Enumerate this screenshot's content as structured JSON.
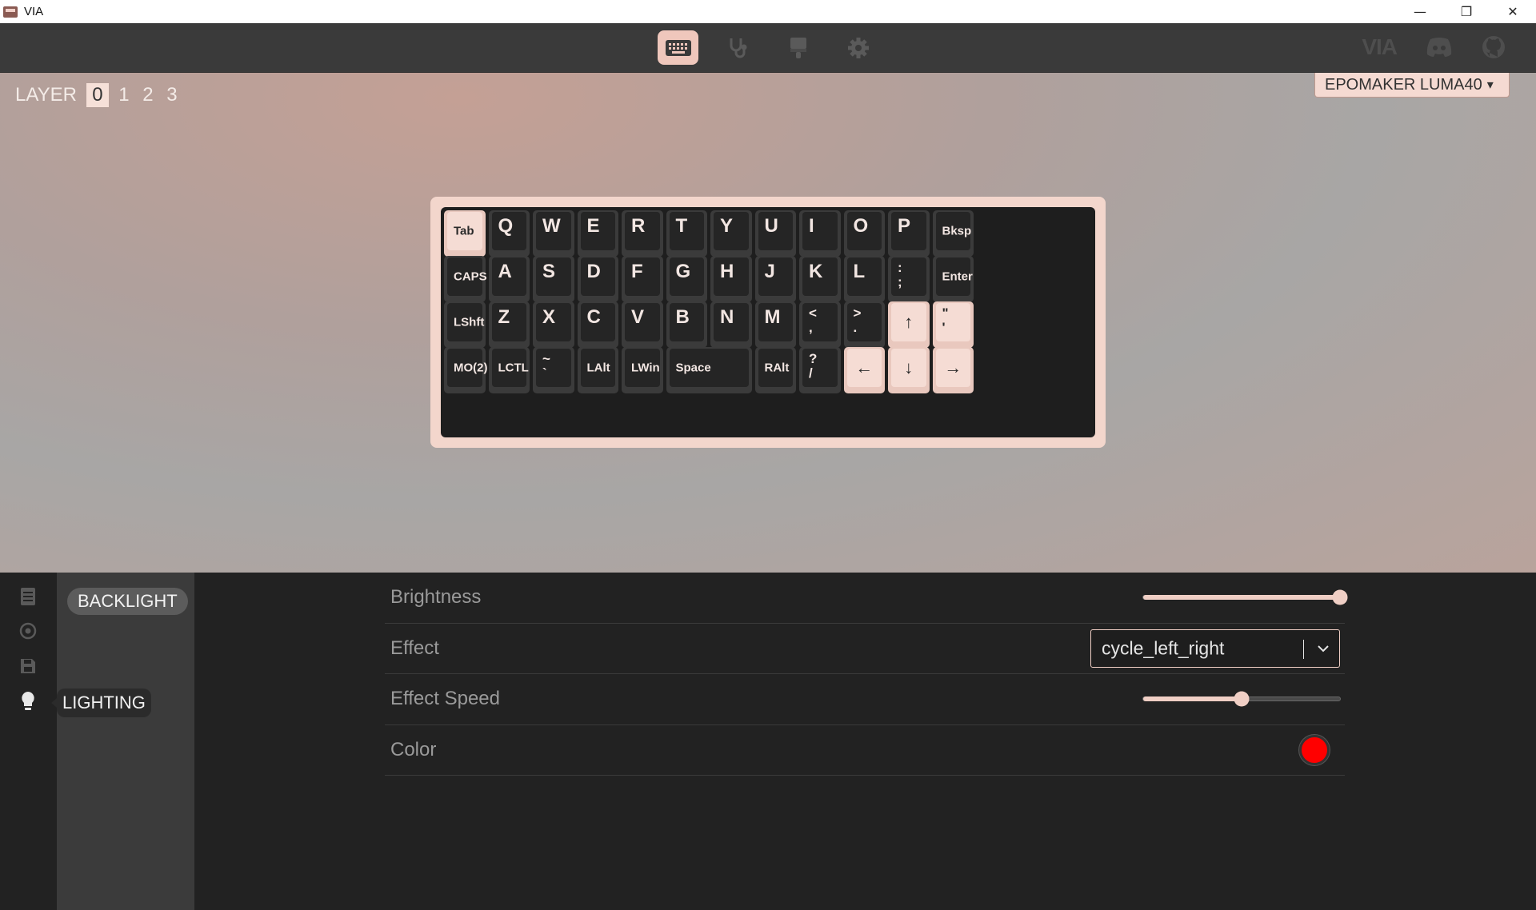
{
  "window": {
    "title": "VIA",
    "controls": [
      "—",
      "❐",
      "✕"
    ]
  },
  "nav": {
    "tabs": [
      {
        "name": "configure",
        "icon": "keyboard-icon",
        "active": true
      },
      {
        "name": "test",
        "icon": "stethoscope-icon",
        "active": false
      },
      {
        "name": "design",
        "icon": "paintbrush-icon",
        "active": false
      },
      {
        "name": "settings",
        "icon": "gear-icon",
        "active": false
      }
    ],
    "brand": "VIA"
  },
  "layers": {
    "label": "LAYER",
    "items": [
      "0",
      "1",
      "2",
      "3"
    ],
    "selected": "0"
  },
  "device": {
    "name": "EPOMAKER LUMA40"
  },
  "keyboard": {
    "rows": [
      [
        {
          "label": "Tab",
          "style": "small",
          "light": true
        },
        {
          "label": "Q",
          "style": "big"
        },
        {
          "label": "W",
          "style": "big"
        },
        {
          "label": "E",
          "style": "big"
        },
        {
          "label": "R",
          "style": "big"
        },
        {
          "label": "T",
          "style": "big"
        },
        {
          "label": "Y",
          "style": "big"
        },
        {
          "label": "U",
          "style": "big"
        },
        {
          "label": "I",
          "style": "big"
        },
        {
          "label": "O",
          "style": "big"
        },
        {
          "label": "P",
          "style": "big"
        },
        {
          "label": "Bksp",
          "style": "small"
        }
      ],
      [
        {
          "label": "CAPS",
          "style": "small"
        },
        {
          "label": "A",
          "style": "big"
        },
        {
          "label": "S",
          "style": "big"
        },
        {
          "label": "D",
          "style": "big"
        },
        {
          "label": "F",
          "style": "big"
        },
        {
          "label": "G",
          "style": "big"
        },
        {
          "label": "H",
          "style": "big"
        },
        {
          "label": "J",
          "style": "big"
        },
        {
          "label": "K",
          "style": "big"
        },
        {
          "label": "L",
          "style": "big"
        },
        {
          "label": ":\n;",
          "style": "dual"
        },
        {
          "label": "Enter",
          "style": "small"
        }
      ],
      [
        {
          "label": "LShft",
          "style": "small"
        },
        {
          "label": "Z",
          "style": "big"
        },
        {
          "label": "X",
          "style": "big"
        },
        {
          "label": "C",
          "style": "big"
        },
        {
          "label": "V",
          "style": "big"
        },
        {
          "label": "B",
          "style": "big"
        },
        {
          "label": "N",
          "style": "big"
        },
        {
          "label": "M",
          "style": "big"
        },
        {
          "label": "<\n,",
          "style": "dual"
        },
        {
          "label": ">\n.",
          "style": "dual"
        },
        {
          "label": "↑",
          "style": "arrow",
          "light": true
        },
        {
          "label": "\"\n'",
          "style": "dual",
          "light": true
        }
      ],
      [
        {
          "label": "MO(2)",
          "style": "small"
        },
        {
          "label": "LCTL",
          "style": "small"
        },
        {
          "label": "~\n`",
          "style": "dual"
        },
        {
          "label": "LAlt",
          "style": "small"
        },
        {
          "label": "LWin",
          "style": "small"
        },
        {
          "label": "Space",
          "style": "small",
          "span": 2
        },
        {
          "label": "RAlt",
          "style": "small"
        },
        {
          "label": "?\n/",
          "style": "dual"
        },
        {
          "label": "←",
          "style": "arrow",
          "light": true
        },
        {
          "label": "↓",
          "style": "arrow",
          "light": true
        },
        {
          "label": "→",
          "style": "arrow",
          "light": true
        }
      ]
    ]
  },
  "sidebar": {
    "icons": [
      "keymap-icon",
      "record-icon",
      "save-icon",
      "lightbulb-icon"
    ],
    "submenu_item": "BACKLIGHT",
    "tooltip": "LIGHTING"
  },
  "controls": {
    "brightness": {
      "label": "Brightness",
      "value": 1.0
    },
    "effect": {
      "label": "Effect",
      "value": "cycle_left_right"
    },
    "speed": {
      "label": "Effect Speed",
      "value": 0.5
    },
    "color": {
      "label": "Color",
      "value": "#ff0000"
    }
  },
  "colors": {
    "accent": "#efc7bc",
    "panel": "#222222",
    "key_dark": "#252525",
    "key_light": "#f5dcd4"
  }
}
